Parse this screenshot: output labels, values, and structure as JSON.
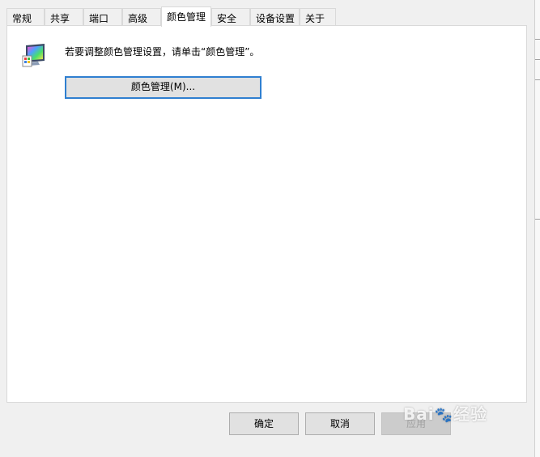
{
  "tabs": [
    {
      "label": "常规",
      "active": false
    },
    {
      "label": "共享",
      "active": false
    },
    {
      "label": "端口",
      "active": false
    },
    {
      "label": "高级",
      "active": false
    },
    {
      "label": "颜色管理",
      "active": true
    },
    {
      "label": "安全",
      "active": false
    },
    {
      "label": "设备设置",
      "active": false
    },
    {
      "label": "关于",
      "active": false
    }
  ],
  "panel": {
    "icon": "color-management-monitor-icon",
    "info_text": "若要调整颜色管理设置，请单击“颜色管理”。",
    "color_button_label": "颜色管理(M)..."
  },
  "footer": {
    "ok_label": "确定",
    "cancel_label": "取消",
    "apply_label": "应用"
  },
  "watermark": {
    "text": "Bai",
    "text2": "经验"
  },
  "colors": {
    "focus_border": "#2f7fd0",
    "window_bg": "#f0f0f0"
  }
}
